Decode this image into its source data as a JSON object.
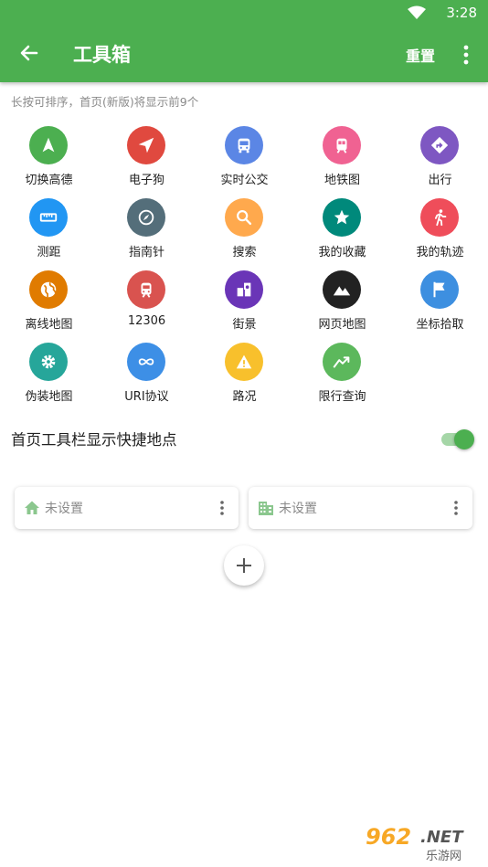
{
  "status_bar": {
    "time": "3:28"
  },
  "header": {
    "title": "工具箱",
    "reset_label": "重置"
  },
  "hint": "长按可排序，首页(新版)将显示前9个",
  "tools": [
    {
      "label": "切换高德",
      "icon": "navigation-arrow-icon",
      "color": "#4caf50"
    },
    {
      "label": "电子狗",
      "icon": "send-arrow-icon",
      "color": "#e0493f"
    },
    {
      "label": "实时公交",
      "icon": "bus-icon",
      "color": "#5b86e5"
    },
    {
      "label": "地铁图",
      "icon": "subway-icon",
      "color": "#f06292"
    },
    {
      "label": "出行",
      "icon": "directions-icon",
      "color": "#7e57c2"
    },
    {
      "label": "测距",
      "icon": "ruler-icon",
      "color": "#2196f3"
    },
    {
      "label": "指南针",
      "icon": "compass-icon",
      "color": "#546e7a"
    },
    {
      "label": "搜索",
      "icon": "search-icon",
      "color": "#ffa94d"
    },
    {
      "label": "我的收藏",
      "icon": "star-icon",
      "color": "#00897b"
    },
    {
      "label": "我的轨迹",
      "icon": "walking-icon",
      "color": "#ef4d5a"
    },
    {
      "label": "离线地图",
      "icon": "globe-icon",
      "color": "#e07b00"
    },
    {
      "label": "12306",
      "icon": "train-icon",
      "color": "#d9534f"
    },
    {
      "label": "街景",
      "icon": "street-view-icon",
      "color": "#6a35b7"
    },
    {
      "label": "网页地图",
      "icon": "terrain-icon",
      "color": "#222222"
    },
    {
      "label": "坐标拾取",
      "icon": "flag-icon",
      "color": "#3d8fe0"
    },
    {
      "label": "伪装地图",
      "icon": "gear-icon",
      "color": "#26a69a"
    },
    {
      "label": "URI协议",
      "icon": "infinity-icon",
      "color": "#3d8fe6"
    },
    {
      "label": "路况",
      "icon": "warning-icon",
      "color": "#f8c02c"
    },
    {
      "label": "限行查询",
      "icon": "trending-icon",
      "color": "#5cb85c"
    }
  ],
  "setting": {
    "label": "首页工具栏显示快捷地点",
    "enabled": true
  },
  "places": [
    {
      "label": "未设置",
      "icon": "home-icon"
    },
    {
      "label": "未设置",
      "icon": "company-icon"
    }
  ],
  "watermark": {
    "num": "962",
    "net": ".NET",
    "sub": "乐游网"
  },
  "colors": {
    "primary": "#4caf50",
    "hint": "#8a8a8a"
  }
}
